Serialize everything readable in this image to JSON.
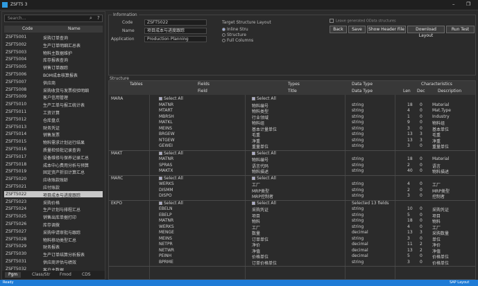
{
  "window": {
    "title": "ZSFT5 3",
    "min": "–",
    "max": "❐"
  },
  "left": {
    "search_placeholder": "Search...",
    "col_code": "Code",
    "col_name": "Name",
    "rows": [
      {
        "code": "ZSFT5001",
        "name": "采购订单查询"
      },
      {
        "code": "ZSFT5002",
        "name": "生产订单明细汇总表"
      },
      {
        "code": "ZSFT5003",
        "name": "物料主数据维护"
      },
      {
        "code": "ZSFT5004",
        "name": "库存报表查询"
      },
      {
        "code": "ZSFT5005",
        "name": "销售订单跟踪"
      },
      {
        "code": "ZSFT5006",
        "name": "BOM成本核算报表"
      },
      {
        "code": "ZSFT5007",
        "name": "供应商"
      },
      {
        "code": "ZSFT5008",
        "name": "采购收货与发票校验明细"
      },
      {
        "code": "ZSFT5009",
        "name": "客户信用管理"
      },
      {
        "code": "ZSFT5010",
        "name": "生产工单与报工统计表"
      },
      {
        "code": "ZSFT5011",
        "name": "工资计算"
      },
      {
        "code": "ZSFT5012",
        "name": "仓库盘点"
      },
      {
        "code": "ZSFT5013",
        "name": "财务凭证"
      },
      {
        "code": "ZSFT5014",
        "name": "销售发票"
      },
      {
        "code": "ZSFT5015",
        "name": "物料需求计划运行结果"
      },
      {
        "code": "ZSFT5016",
        "name": "质量检验批记录查询"
      },
      {
        "code": "ZSFT5017",
        "name": "设备维修与保养记录汇总"
      },
      {
        "code": "ZSFT5018",
        "name": "成本中心费用分析与预算"
      },
      {
        "code": "ZSFT5019",
        "name": "固定资产折旧计算汇总"
      },
      {
        "code": "ZSFT5020",
        "name": "应收账款账龄"
      },
      {
        "code": "ZSFT5021",
        "name": "应付账款"
      },
      {
        "code": "ZSFT5022",
        "name": "项目成本与进度跟踪"
      },
      {
        "code": "ZSFT5023",
        "name": "采购价格"
      },
      {
        "code": "ZSFT5024",
        "name": "生产计划与排程汇总"
      },
      {
        "code": "ZSFT5025",
        "name": "销售出库单据打印"
      },
      {
        "code": "ZSFT5026",
        "name": "库存调拨"
      },
      {
        "code": "ZSFT5027",
        "name": "采购申请审批与跟踪"
      },
      {
        "code": "ZSFT5028",
        "name": "物料移动类型汇总"
      },
      {
        "code": "ZSFT5029",
        "name": "财务报表"
      },
      {
        "code": "ZSFT5030",
        "name": "生产订单结算分析报表"
      },
      {
        "code": "ZSFT5031",
        "name": "供应商评估与绩效"
      },
      {
        "code": "ZSFT5032",
        "name": "客户主数据"
      }
    ],
    "selected_index": 21,
    "tabs": [
      "Pgm",
      "Class/Str",
      "Fmod",
      "CDS"
    ]
  },
  "header": {
    "group_label": "Information",
    "code_label": "Code",
    "code_value": "ZSFT5022",
    "name_label": "Name",
    "name_value": "项目成本与进度跟踪",
    "app_label": "Application",
    "app_value": "Production Planning",
    "target_label": "Target Structure Layout",
    "radios": [
      "Inline Stru",
      "Structure",
      "Full Columns"
    ],
    "radio_on": 0,
    "checkbox_label": "Leave generated OData structures",
    "buttons": [
      "Back",
      "Save",
      "Show Header File",
      "Download Layout",
      "Run Test"
    ]
  },
  "table": {
    "group_label": "Structure",
    "head1": [
      "Tables",
      "Fields",
      "Types",
      "Data Type",
      "Characteristics"
    ],
    "head2": [
      "Field",
      "Title",
      "Data Type",
      "Len",
      "Dec",
      "Description"
    ],
    "sections": [
      {
        "table": "MARA",
        "rows": [
          {
            "f": "Select All",
            "t": "Select All",
            "d": "",
            "l": "",
            "dc": "",
            "ds": "",
            "chk": true
          },
          {
            "f": "MATNR",
            "t": "物料编号",
            "d": "string",
            "l": "18",
            "dc": "0",
            "ds": "Material"
          },
          {
            "f": "MTART",
            "t": "物料类型",
            "d": "string",
            "l": "4",
            "dc": "0",
            "ds": "Mat.Type"
          },
          {
            "f": "MBRSH",
            "t": "行业领域",
            "d": "string",
            "l": "1",
            "dc": "0",
            "ds": "Industry"
          },
          {
            "f": "MATKL",
            "t": "物料组",
            "d": "string",
            "l": "9",
            "dc": "0",
            "ds": "物料组"
          },
          {
            "f": "MEINS",
            "t": "基本计量单位",
            "d": "string",
            "l": "3",
            "dc": "0",
            "ds": "基本单位"
          },
          {
            "f": "BRGEW",
            "t": "毛重",
            "d": "string",
            "l": "13",
            "dc": "3",
            "ds": "毛重"
          },
          {
            "f": "NTGEW",
            "t": "净重",
            "d": "string",
            "l": "13",
            "dc": "3",
            "ds": "净重"
          },
          {
            "f": "GEWEI",
            "t": "重量单位",
            "d": "string",
            "l": "3",
            "dc": "0",
            "ds": "重量单位"
          }
        ]
      },
      {
        "table": "MAKT",
        "rows": [
          {
            "f": "Select All",
            "t": "Select All",
            "d": "",
            "l": "",
            "dc": "",
            "ds": "",
            "chk": true
          },
          {
            "f": "MATNR",
            "t": "物料编号",
            "d": "string",
            "l": "18",
            "dc": "0",
            "ds": "Material"
          },
          {
            "f": "SPRAS",
            "t": "语言代码",
            "d": "string",
            "l": "2",
            "dc": "0",
            "ds": "语言"
          },
          {
            "f": "MAKTX",
            "t": "物料描述",
            "d": "string",
            "l": "40",
            "dc": "0",
            "ds": "物料描述"
          }
        ]
      },
      {
        "table": "MARC",
        "rows": [
          {
            "f": "Select All",
            "t": "Select All",
            "d": "",
            "l": "",
            "dc": "",
            "ds": "",
            "chk": true
          },
          {
            "f": "WERKS",
            "t": "工厂",
            "d": "string",
            "l": "4",
            "dc": "0",
            "ds": "工厂"
          },
          {
            "f": "DISMM",
            "t": "MRP类型",
            "d": "string",
            "l": "2",
            "dc": "0",
            "ds": "MRP类型"
          },
          {
            "f": "DISPO",
            "t": "MRP控制者",
            "d": "string",
            "l": "3",
            "dc": "0",
            "ds": "控制者"
          }
        ]
      },
      {
        "table": "EKPO",
        "rows": [
          {
            "f": "Select All",
            "t": "Select All",
            "d": "Selected 13 fields",
            "l": "",
            "dc": "",
            "ds": "",
            "chk": true
          },
          {
            "f": "EBELN",
            "t": "采购凭证",
            "d": "string",
            "l": "10",
            "dc": "0",
            "ds": "采购凭证"
          },
          {
            "f": "EBELP",
            "t": "项目",
            "d": "string",
            "l": "5",
            "dc": "0",
            "ds": "项目"
          },
          {
            "f": "MATNR",
            "t": "物料",
            "d": "string",
            "l": "18",
            "dc": "0",
            "ds": "物料"
          },
          {
            "f": "WERKS",
            "t": "工厂",
            "d": "string",
            "l": "4",
            "dc": "0",
            "ds": "工厂"
          },
          {
            "f": "MENGE",
            "t": "数量",
            "d": "decimal",
            "l": "13",
            "dc": "3",
            "ds": "采购数量"
          },
          {
            "f": "MEINS",
            "t": "订单单位",
            "d": "string",
            "l": "3",
            "dc": "0",
            "ds": "单位"
          },
          {
            "f": "NETPR",
            "t": "净价",
            "d": "decimal",
            "l": "11",
            "dc": "2",
            "ds": "净价"
          },
          {
            "f": "NETWR",
            "t": "净值",
            "d": "decimal",
            "l": "13",
            "dc": "2",
            "ds": "净值"
          },
          {
            "f": "PEINH",
            "t": "价格单位",
            "d": "decimal",
            "l": "5",
            "dc": "0",
            "ds": "价格单位"
          },
          {
            "f": "BPRME",
            "t": "订单价格单位",
            "d": "string",
            "l": "3",
            "dc": "0",
            "ds": "价格单位"
          }
        ]
      }
    ]
  },
  "status": {
    "left": "Ready",
    "right": "SAP Layout"
  }
}
